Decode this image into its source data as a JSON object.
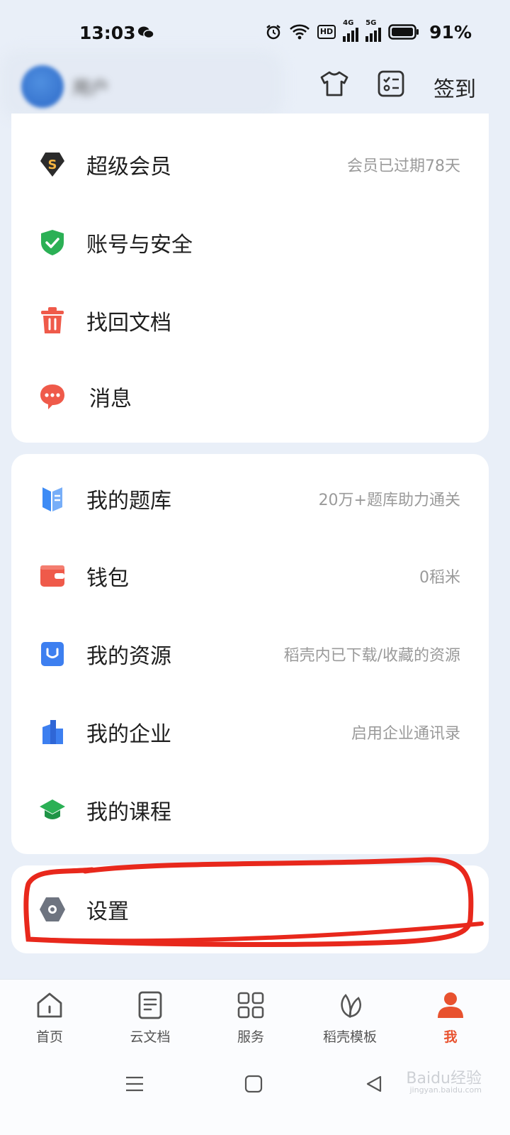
{
  "status_bar": {
    "time": "13:03",
    "network_badge": "HD",
    "signal_1_label": "4G",
    "signal_2_label": "5G",
    "battery": "91%"
  },
  "header": {
    "username": "用户",
    "checkin_label": "签到"
  },
  "menu_group_1": [
    {
      "label": "超级会员",
      "sub": "会员已过期78天",
      "icon": "super-vip-icon"
    },
    {
      "label": "账号与安全",
      "sub": "",
      "icon": "shield-check-icon"
    },
    {
      "label": "找回文档",
      "sub": "",
      "icon": "trash-icon"
    },
    {
      "label": "消息",
      "sub": "",
      "icon": "message-bubble-icon"
    }
  ],
  "menu_group_2": [
    {
      "label": "我的题库",
      "sub": "20万+题库助力通关",
      "icon": "question-bank-icon"
    },
    {
      "label": "钱包",
      "sub": "0稻米",
      "icon": "wallet-icon"
    },
    {
      "label": "我的资源",
      "sub": "稻壳内已下载/收藏的资源",
      "icon": "resource-icon"
    },
    {
      "label": "我的企业",
      "sub": "启用企业通讯录",
      "icon": "enterprise-icon"
    },
    {
      "label": "我的课程",
      "sub": "",
      "icon": "graduation-cap-icon"
    }
  ],
  "menu_group_3": [
    {
      "label": "设置",
      "sub": "",
      "icon": "gear-icon"
    }
  ],
  "tab_bar": [
    {
      "label": "首页",
      "icon": "home-icon",
      "active": false
    },
    {
      "label": "云文档",
      "icon": "document-icon",
      "active": false
    },
    {
      "label": "服务",
      "icon": "grid-icon",
      "active": false
    },
    {
      "label": "稻壳模板",
      "icon": "leaf-icon",
      "active": false
    },
    {
      "label": "我",
      "icon": "person-icon",
      "active": true
    }
  ],
  "watermark": {
    "text": "Baidu经验",
    "sub": "jingyan.baidu.com"
  },
  "colors": {
    "accent": "#e8522f",
    "annotation": "#e8281c",
    "background": "#e9eff8"
  }
}
